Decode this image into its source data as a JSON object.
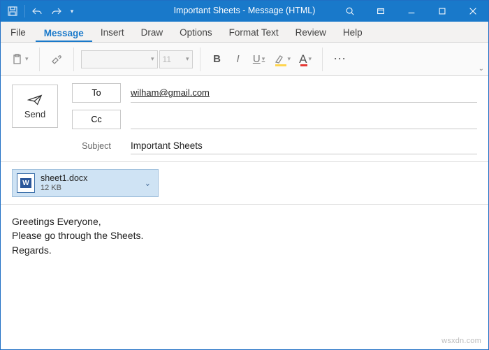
{
  "titlebar": {
    "title": "Important Sheets  -  Message (HTML)"
  },
  "tabs": {
    "file": "File",
    "message": "Message",
    "insert": "Insert",
    "draw": "Draw",
    "options": "Options",
    "format_text": "Format Text",
    "review": "Review",
    "help": "Help"
  },
  "ribbon": {
    "font_size_placeholder": "11",
    "bold": "B",
    "italic": "I",
    "underline": "U",
    "font_a": "A",
    "more": "⋯"
  },
  "header": {
    "send_label": "Send",
    "to_label": "To",
    "cc_label": "Cc",
    "to_value": "wilham@gmail.com",
    "cc_value": "",
    "subject_label": "Subject",
    "subject_value": "Important Sheets"
  },
  "attachment": {
    "name": "sheet1.docx",
    "size": "12 KB",
    "icon_letter": "W"
  },
  "body": {
    "text": "Greetings Everyone,\nPlease go through the Sheets.\nRegards."
  },
  "watermark": "wsxdn.com"
}
